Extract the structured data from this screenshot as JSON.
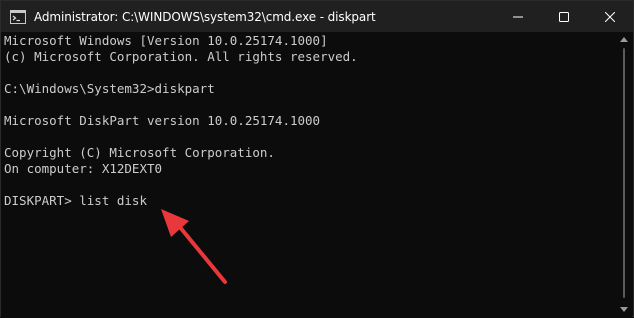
{
  "window": {
    "title": "Administrator: C:\\WINDOWS\\system32\\cmd.exe - diskpart",
    "icon": "cmd-icon",
    "controls": [
      "minimize-icon",
      "maximize-icon",
      "close-icon"
    ]
  },
  "console": {
    "lines": [
      "Microsoft Windows [Version 10.0.25174.1000]",
      "(c) Microsoft Corporation. All rights reserved.",
      "",
      "C:\\Windows\\System32>diskpart",
      "",
      "Microsoft DiskPart version 10.0.25174.1000",
      "",
      "Copyright (C) Microsoft Corporation.",
      "On computer: X12DEXT0",
      "",
      "DISKPART> list disk"
    ]
  },
  "annotation": {
    "type": "arrow",
    "color": "#e8383b",
    "points_to": "console.lines.10"
  },
  "colors": {
    "titlebar": "#202020",
    "console_bg": "#0c0c0c",
    "console_text": "#cccccc"
  }
}
